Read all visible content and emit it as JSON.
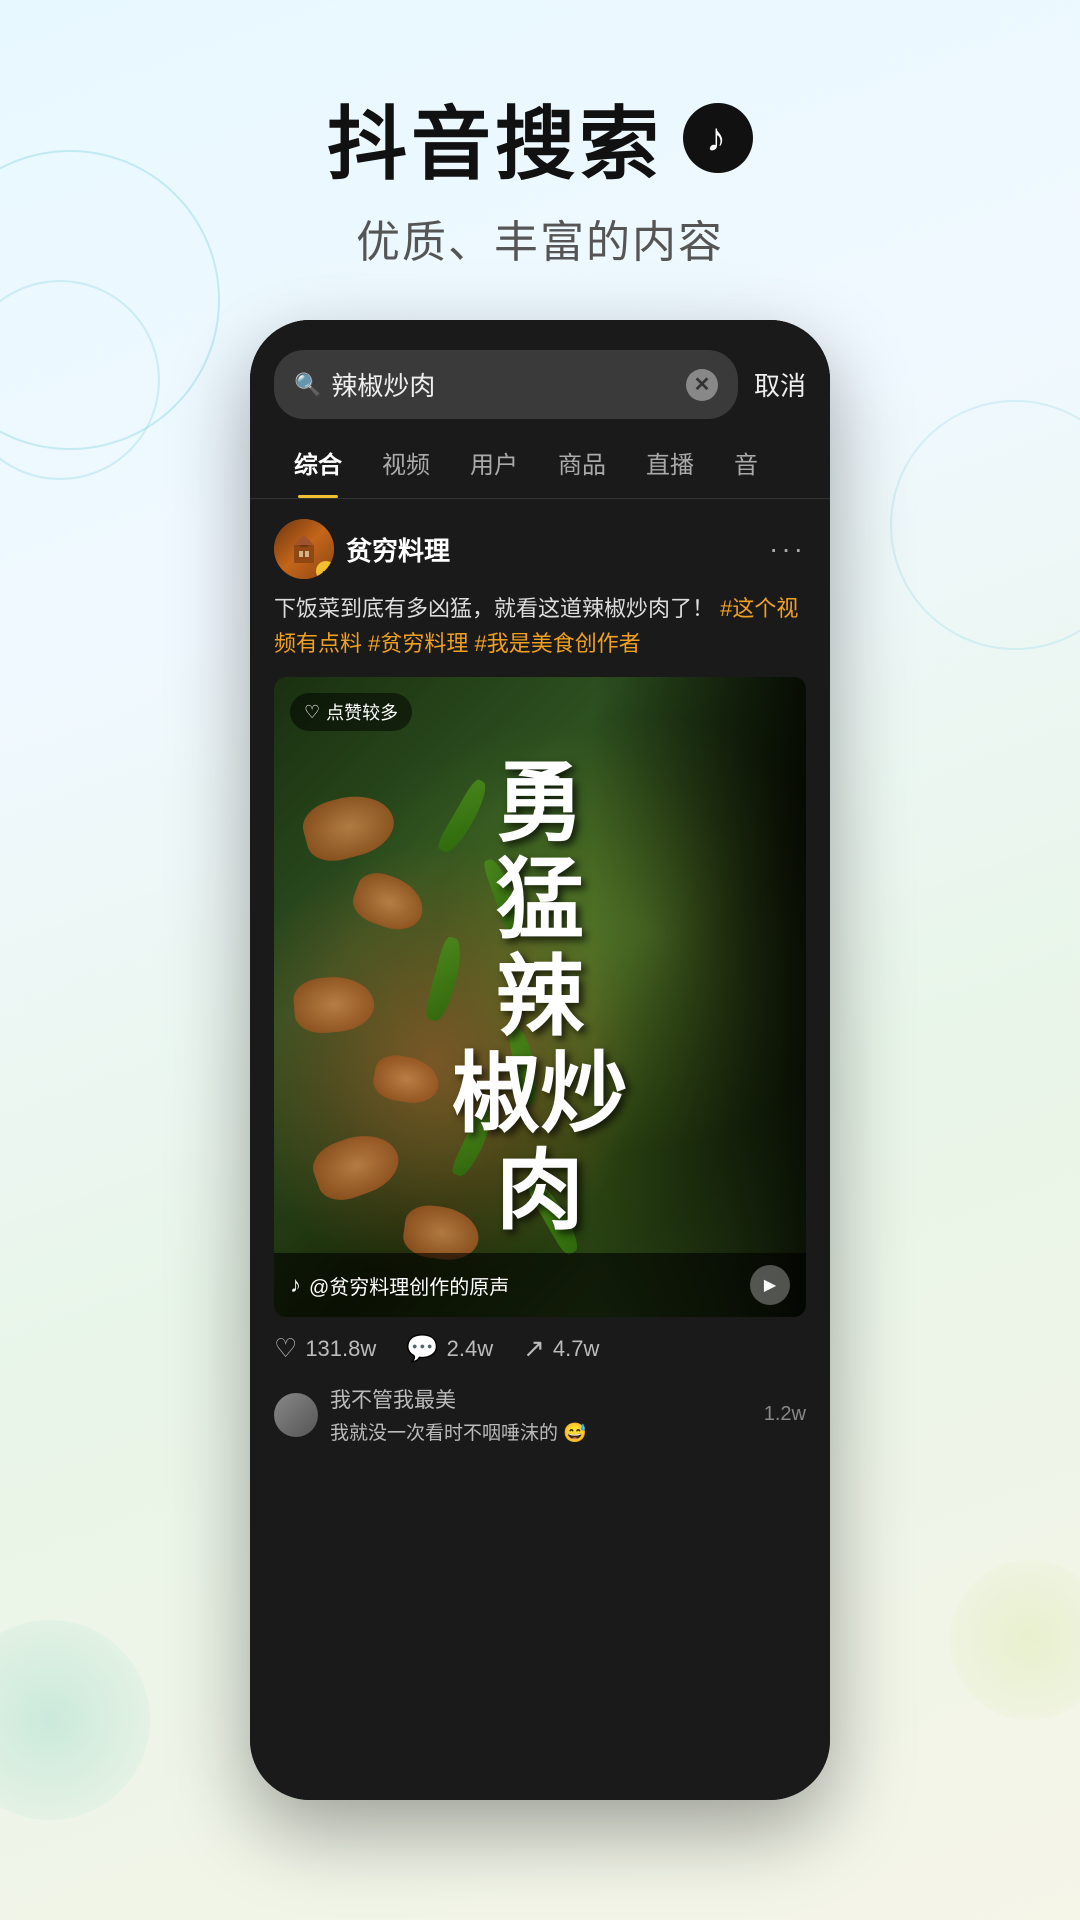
{
  "header": {
    "main_title": "抖音搜索",
    "subtitle": "优质、丰富的内容"
  },
  "search_bar": {
    "query": "辣椒炒肉",
    "cancel_label": "取消"
  },
  "tabs": [
    {
      "label": "综合",
      "active": true
    },
    {
      "label": "视频",
      "active": false
    },
    {
      "label": "用户",
      "active": false
    },
    {
      "label": "商品",
      "active": false
    },
    {
      "label": "直播",
      "active": false
    },
    {
      "label": "音",
      "active": false
    }
  ],
  "post": {
    "author_name": "贫穷料理",
    "post_body": "下饭菜到底有多凶猛，就看这道辣椒炒肉了！",
    "hashtags": "#这个视频有点料 #贫穷料理 #我是美食创作者",
    "video_title_line1": "勇",
    "video_title_line2": "猛",
    "video_title_line3": "辣",
    "video_title_line4": "椒炒",
    "video_title_line5": "肉",
    "likes_badge": "点赞较多",
    "audio_label": "@贫穷料理创作的原声",
    "likes_count": "131.8w",
    "comments_count": "2.4w",
    "shares_count": "4.7w",
    "comment_text": "我不管我最美",
    "comment_subtext": "我就没一次看时不咽唾沫的 😅",
    "comment_count_right": "1.2w"
  }
}
